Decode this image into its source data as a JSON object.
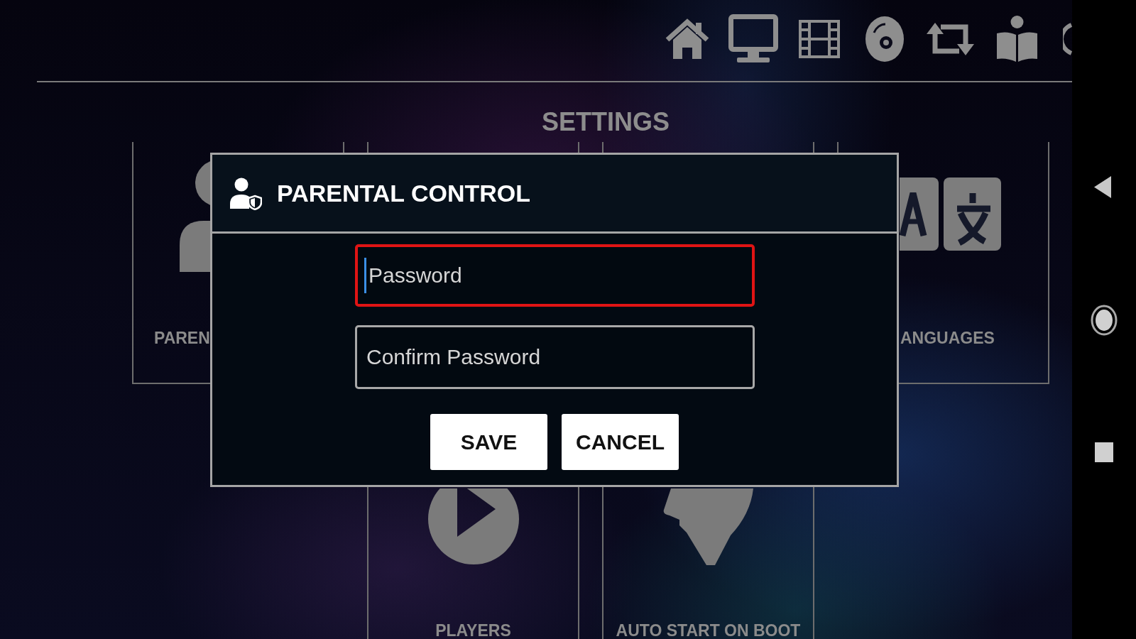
{
  "settings": {
    "title": "SETTINGS",
    "tiles": [
      {
        "label": "PAREN"
      },
      {
        "label": "ANGUAGES"
      },
      {
        "label": "PLAYERS"
      },
      {
        "label": "AUTO START ON BOOT"
      }
    ]
  },
  "dialog": {
    "title": "PARENTAL CONTROL",
    "fields": [
      {
        "placeholder": "Password",
        "focused": true
      },
      {
        "placeholder": "Confirm Password",
        "focused": false
      }
    ],
    "buttons": [
      "SAVE",
      "CANCEL"
    ]
  }
}
